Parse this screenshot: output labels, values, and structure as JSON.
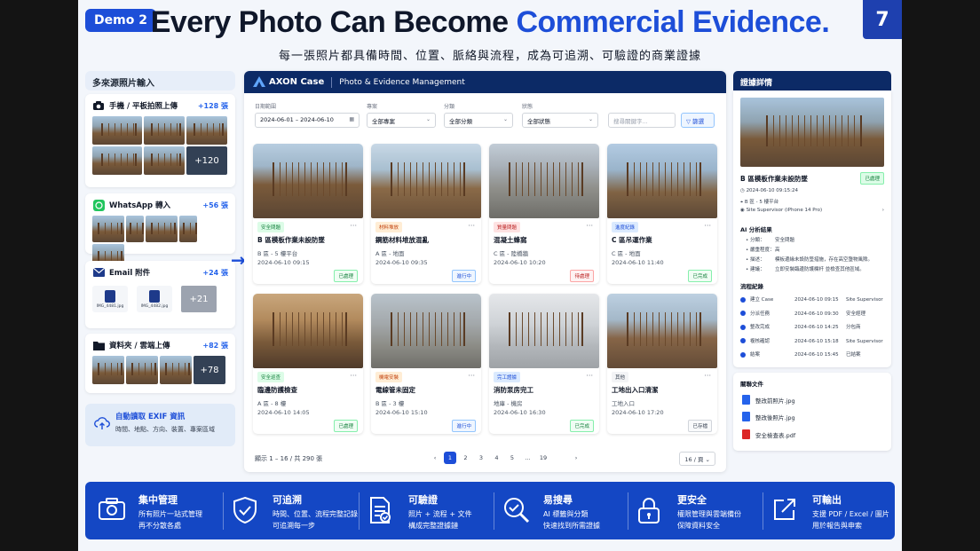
{
  "demo_label": "Demo 2",
  "page_number": "7",
  "title_plain": "Every Photo Can Become ",
  "title_highlight": "Commercial Evidence.",
  "subtitle": "每一張照片都具備時間、位置、脈絡與流程，成為可追溯、可驗證的商業證據",
  "colors": {
    "brand": "#1d4ed8",
    "navy": "#0c2a66",
    "footer": "#1447c4"
  },
  "left": {
    "header": "多來源照片輸入",
    "sources": [
      {
        "label": "手機 / 平板拍照上傳",
        "count": "+128 張",
        "icon": "camera-icon",
        "more": "+120"
      },
      {
        "label": "WhatsApp 轉入",
        "count": "+56 張",
        "icon": "whatsapp-icon"
      },
      {
        "label": "Email 附件",
        "count": "+24 張",
        "icon": "email-icon",
        "more": "+21",
        "files": [
          "IMG_4481.jpg",
          "IMG_4482.jpg"
        ]
      },
      {
        "label": "資料夾 / 雲端上傳",
        "count": "+82 張",
        "icon": "folder-icon",
        "more": "+78"
      }
    ],
    "exif": {
      "title": "自動讀取 EXIF 資訊",
      "desc": "時間、地點、方向、裝置、專案區域",
      "icon": "upload-cloud-icon"
    }
  },
  "app": {
    "logo": "AXON Case",
    "subtitle": "Photo & Evidence Management",
    "filters": {
      "date_label": "日期範圍",
      "date_value": "2024-06-01 – 2024-06-10",
      "project_label": "專案",
      "project_value": "全部專案",
      "category_label": "分類",
      "category_value": "全部分類",
      "status_label": "狀態",
      "status_value": "全部狀態",
      "search_placeholder": "搜尋關鍵字...",
      "filter_button": "篩選"
    },
    "cards": [
      {
        "tag": "安全問題",
        "title": "B 區模板作業未設防墜",
        "loc": "B 區 - 5 樓平台",
        "date": "2024-06-10 09:15",
        "status": "已處理",
        "tag_color": "green",
        "status_color": "green"
      },
      {
        "tag": "材料堆放",
        "title": "鋼筋材料堆放混亂",
        "loc": "A 區 - 地面",
        "date": "2024-06-10 09:35",
        "status": "進行中",
        "tag_color": "orange",
        "status_color": "blue"
      },
      {
        "tag": "質量問題",
        "title": "混凝土蜂窩",
        "loc": "C 區 - 陸橋牆",
        "date": "2024-06-10 10:20",
        "status": "待處理",
        "tag_color": "red",
        "status_color": "red"
      },
      {
        "tag": "進度紀錄",
        "title": "C 區吊運作業",
        "loc": "C 區 - 地面",
        "date": "2024-06-10 11:40",
        "status": "已完成",
        "tag_color": "blue",
        "status_color": "green"
      },
      {
        "tag": "安全巡查",
        "title": "臨邊防護檢查",
        "loc": "A 區 - 8 樓",
        "date": "2024-06-10 14:05",
        "status": "已處理",
        "tag_color": "green",
        "status_color": "green"
      },
      {
        "tag": "機電安裝",
        "title": "電線管未固定",
        "loc": "B 區 - 3 樓",
        "date": "2024-06-10 15:10",
        "status": "進行中",
        "tag_color": "orange",
        "status_color": "blue"
      },
      {
        "tag": "完工證據",
        "title": "消防泵房完工",
        "loc": "地庫 - 機房",
        "date": "2024-06-10 16:30",
        "status": "已完成",
        "tag_color": "blue",
        "status_color": "green"
      },
      {
        "tag": "其他",
        "title": "工地出入口清潔",
        "loc": "工地入口",
        "date": "2024-06-10 17:20",
        "status": "已存檔",
        "tag_color": "gray",
        "status_color": "gray"
      }
    ],
    "pager": {
      "summary": "顯示 1 – 16 / 共 290 張",
      "pages": [
        "1",
        "2",
        "3",
        "4",
        "5",
        "...",
        "19"
      ],
      "per_page": "16 / 頁"
    }
  },
  "detail": {
    "header": "證據詳情",
    "title": "B 區模板作業未設防墜",
    "tag": "已處理",
    "time": "2024-06-10 09:15:24",
    "location": "B 區 - 5 樓平台",
    "device": "Site Supervisor (iPhone 14 Pro)",
    "ai_title": "AI 分析結果",
    "ai": [
      {
        "k": "分類：",
        "v": "安全問題"
      },
      {
        "k": "嚴重程度：",
        "v": "高"
      },
      {
        "k": "描述：",
        "v": "模板邊緣未設防墜措施，存在高空墮物風險。"
      },
      {
        "k": "建議：",
        "v": "立即安裝臨邊防護欄杆 並檢查其他區域。"
      }
    ],
    "flow_title": "流程紀錄",
    "flow": [
      {
        "step": "建立 Case",
        "time": "2024-06-10 09:15",
        "who": "Site Supervisor"
      },
      {
        "step": "分派任務",
        "time": "2024-06-10 09:30",
        "who": "安全經理"
      },
      {
        "step": "整改完成",
        "time": "2024-06-10 14:25",
        "who": "分包商"
      },
      {
        "step": "複核確認",
        "time": "2024-06-10 15:18",
        "who": "Site Supervisor"
      },
      {
        "step": "結案",
        "time": "2024-06-10 15:45",
        "who": "已結案"
      }
    ],
    "docs_title": "關聯文件",
    "docs": [
      "整改前照片.jpg",
      "整改後照片.jpg",
      "安全檢查表.pdf"
    ]
  },
  "features": [
    {
      "t": "集中管理",
      "s1": "所有照片一站式管理",
      "s2": "再不分散各處",
      "icon": "camera-icon"
    },
    {
      "t": "可追溯",
      "s1": "時間、位置、流程完整記錄",
      "s2": "可追溯每一步",
      "icon": "shield-check-icon"
    },
    {
      "t": "可驗證",
      "s1": "照片 + 流程 + 文件",
      "s2": "構成完整證據鏈",
      "icon": "document-check-icon"
    },
    {
      "t": "易搜尋",
      "s1": "AI 標籤與分類",
      "s2": "快速找到所需證據",
      "icon": "search-icon"
    },
    {
      "t": "更安全",
      "s1": "權限管理與雲端備份",
      "s2": "保障資料安全",
      "icon": "lock-icon"
    },
    {
      "t": "可輸出",
      "s1": "支援 PDF / Excel / 圖片",
      "s2": "用於報告與申索",
      "icon": "export-icon"
    }
  ]
}
